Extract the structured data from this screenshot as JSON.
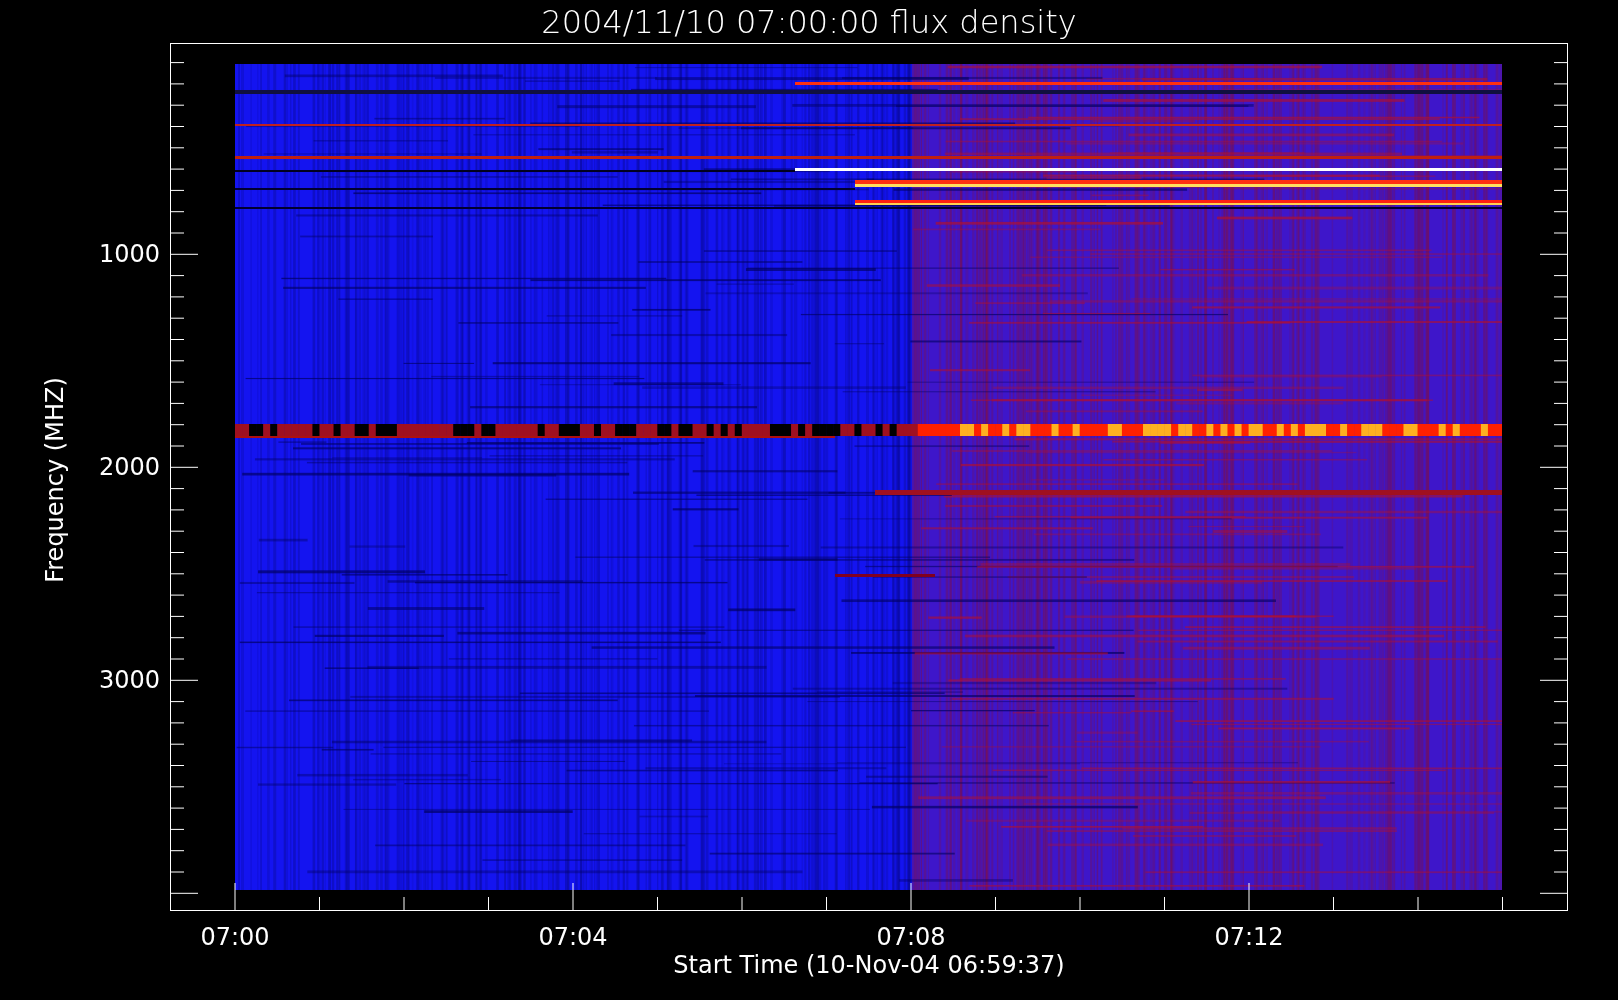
{
  "title": "2004/11/10 07:00:00 flux density",
  "y_axis": {
    "label": "Frequency (MHZ)",
    "ticks": [
      "1000",
      "2000",
      "3000"
    ]
  },
  "x_axis": {
    "label": "Start Time (10-Nov-04 06:59:37)",
    "ticks": [
      "07:00",
      "07:04",
      "07:08",
      "07:12"
    ]
  }
}
